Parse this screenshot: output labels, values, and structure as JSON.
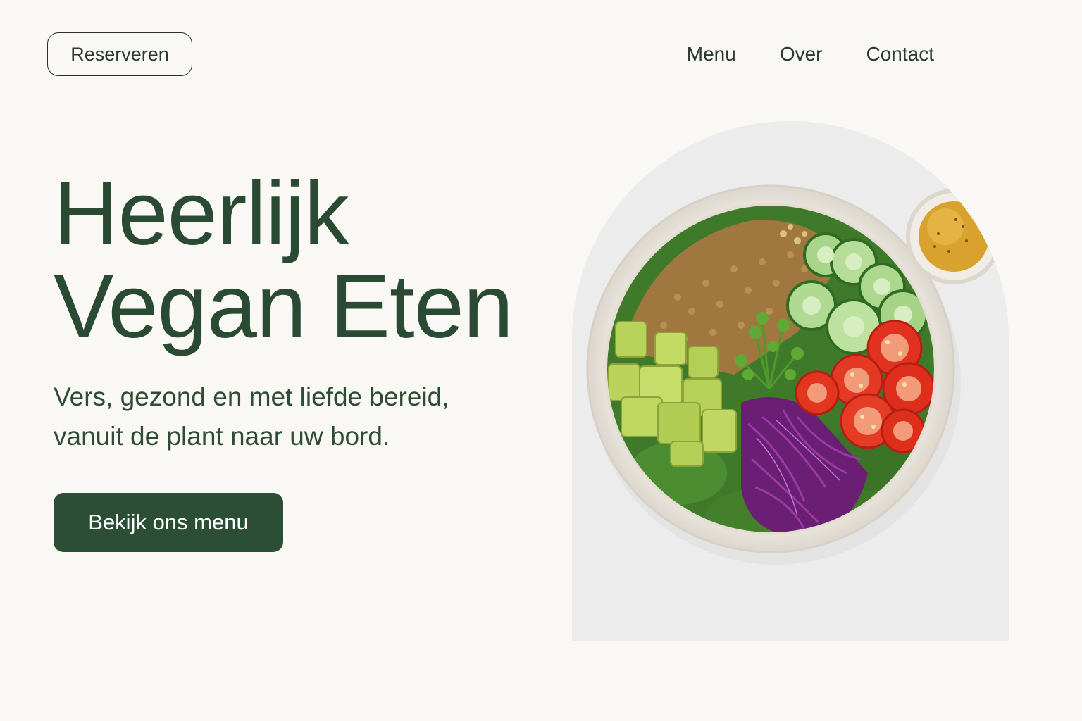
{
  "header": {
    "reserve_label": "Reserveren",
    "nav": [
      {
        "label": "Menu"
      },
      {
        "label": "Over"
      },
      {
        "label": "Contact"
      }
    ]
  },
  "hero": {
    "title_line1": "Heerlijk",
    "title_line2": "Vegan Eten",
    "subtitle_line1": "Vers, gezond en met liefde bereid,",
    "subtitle_line2": "vanuit de plant naar uw bord.",
    "cta_label": "Bekijk ons menu"
  },
  "image": {
    "icon": "salad-bowl-photo"
  },
  "colors": {
    "background": "#faf8f4",
    "brand_green": "#2d4e36",
    "text_green": "#2b4a34"
  }
}
